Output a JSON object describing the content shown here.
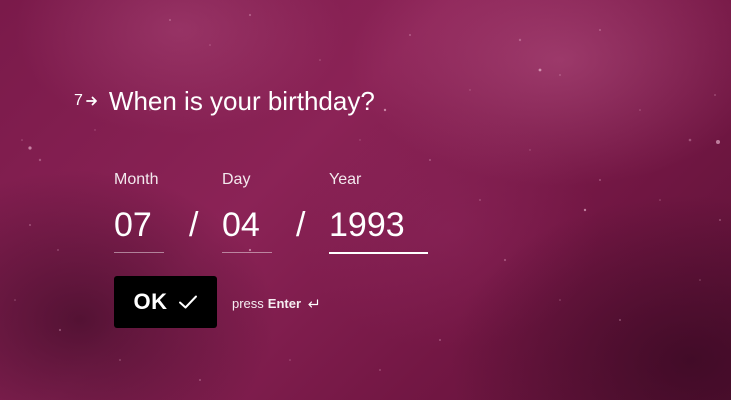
{
  "question": {
    "number": "7",
    "arrow_icon": "arrow-right-icon",
    "title": "When is your birthday?"
  },
  "date_fields": {
    "month": {
      "label": "Month",
      "value": "07"
    },
    "day": {
      "label": "Day",
      "value": "04"
    },
    "year": {
      "label": "Year",
      "value": "1993"
    },
    "separator": "/"
  },
  "ok_button": {
    "label": "OK",
    "icon": "check-icon"
  },
  "hint": {
    "prefix": "press",
    "key": "Enter",
    "icon": "enter-return-icon"
  },
  "colors": {
    "background": "#7a1a4a",
    "button": "#000000",
    "text": "#ffffff"
  }
}
